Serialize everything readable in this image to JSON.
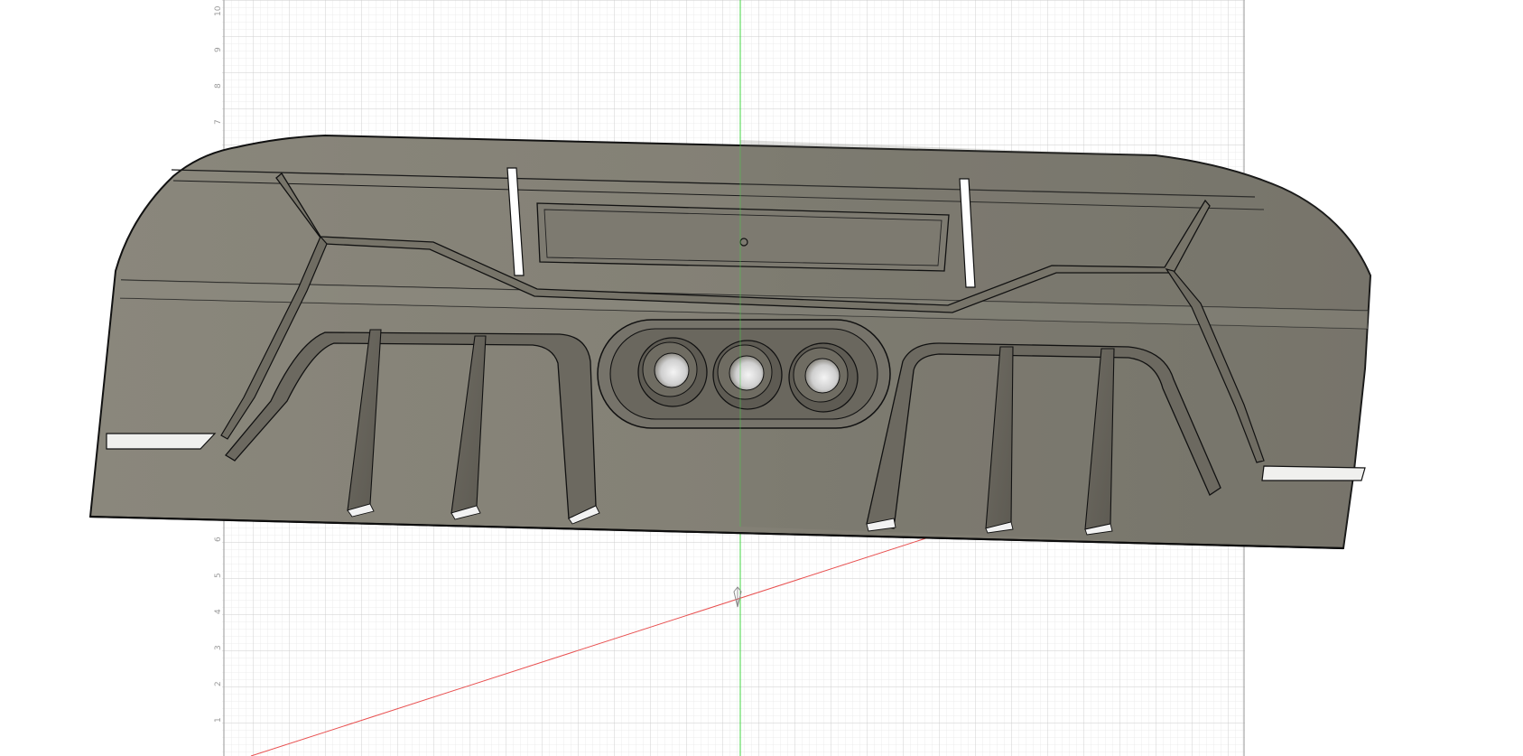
{
  "viewport": {
    "background": "#ffffff",
    "grid_minor_color": "#e4e4e4",
    "grid_major_color": "#c8c8c8",
    "y_axis_color": "#46d446",
    "x_axis_color": "#e85050",
    "ruler_labels": [
      "10",
      "9",
      "8",
      "7",
      "6",
      "5",
      "4",
      "3",
      "2",
      "1",
      "0"
    ]
  },
  "model": {
    "body_color": "#7f7c72",
    "body_color_light": "#8e8b80",
    "edge_color": "#111111",
    "origin_marker": "origin-icon"
  }
}
